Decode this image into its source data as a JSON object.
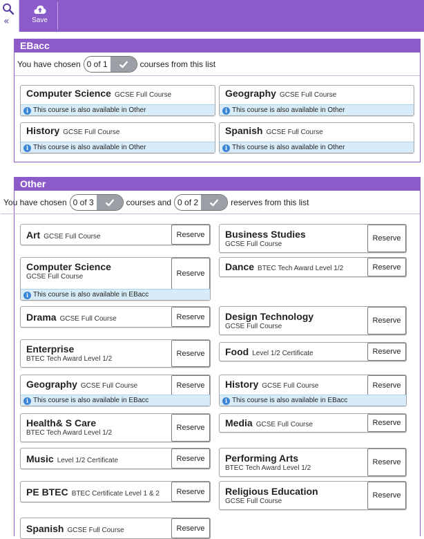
{
  "toolbar": {
    "save_label": "Save",
    "accent": "#8a5bc9"
  },
  "ebacc": {
    "title": "EBacc",
    "chooser": {
      "prefix": "You have chosen",
      "count": "0 of 1",
      "suffix": "courses from this list"
    },
    "courses": [
      {
        "name": "Computer Science",
        "level": "GCSE Full Course",
        "info": "This course is also available in Other"
      },
      {
        "name": "Geography",
        "level": "GCSE Full Course",
        "info": "This course is also available in Other"
      },
      {
        "name": "History",
        "level": "GCSE Full Course",
        "info": "This course is also available in Other"
      },
      {
        "name": "Spanish",
        "level": "GCSE Full Course",
        "info": "This course is also available in Other"
      }
    ]
  },
  "other": {
    "title": "Other",
    "chooser": {
      "prefix": "You have chosen",
      "count": "0 of 3",
      "middle": "courses and",
      "reserve_count": "0 of 2",
      "suffix": "reserves from this list"
    },
    "reserve_label": "Reserve",
    "courses": [
      {
        "name": "Art",
        "level": "GCSE Full Course"
      },
      {
        "name": "Business Studies",
        "level": "GCSE Full Course"
      },
      {
        "name": "Computer Science",
        "level": "GCSE Full Course",
        "info": "This course is also available in EBacc"
      },
      {
        "name": "Dance",
        "level": "BTEC Tech Award Level 1/2"
      },
      {
        "name": "Drama",
        "level": "GCSE Full Course"
      },
      {
        "name": "Design Technology",
        "level": "GCSE Full Course"
      },
      {
        "name": "Enterprise",
        "level": "BTEC Tech Award Level 1/2"
      },
      {
        "name": "Food",
        "level": "Level 1/2 Certificate"
      },
      {
        "name": "Geography",
        "level": "GCSE Full Course",
        "info": "This course is also available in EBacc"
      },
      {
        "name": "History",
        "level": "GCSE Full Course",
        "info": "This course is also available in EBacc"
      },
      {
        "name": "Health& S Care",
        "level": "BTEC Tech Award Level 1/2"
      },
      {
        "name": "Media",
        "level": "GCSE Full Course"
      },
      {
        "name": "Music",
        "level": "Level 1/2 Certificate"
      },
      {
        "name": "Performing Arts",
        "level": "BTEC Tech Award Level 1/2"
      },
      {
        "name": "PE BTEC",
        "level": "BTEC Certificate Level 1 & 2"
      },
      {
        "name": "Religious Education",
        "level": "GCSE Full Course"
      },
      {
        "name": "Spanish",
        "level": "GCSE Full Course"
      }
    ]
  }
}
